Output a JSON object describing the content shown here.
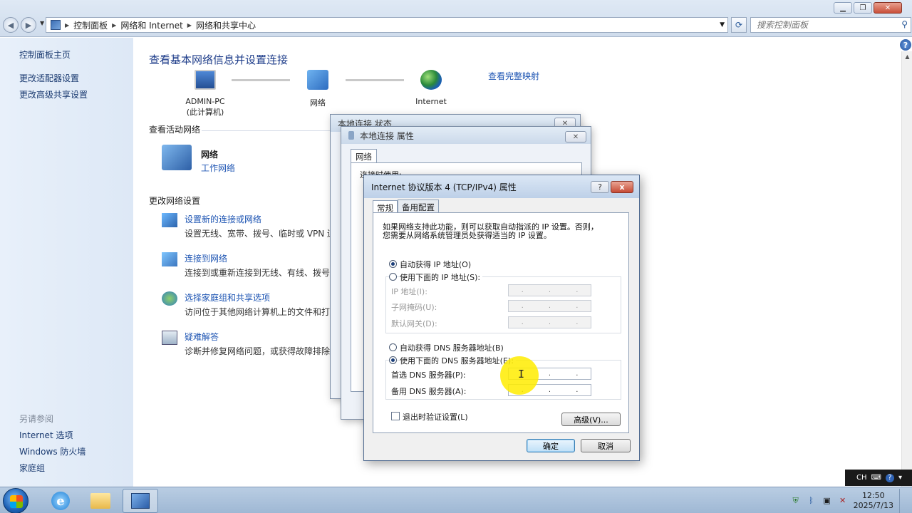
{
  "address": {
    "crumbs": [
      "控制面板",
      "网络和 Internet",
      "网络和共享中心"
    ],
    "search_placeholder": "搜索控制面板"
  },
  "sidebar": {
    "items": [
      "控制面板主页",
      "更改适配器设置",
      "更改高级共享设置"
    ],
    "see_also_title": "另请参阅",
    "see_also": [
      "Internet 选项",
      "Windows 防火墙",
      "家庭组"
    ]
  },
  "main": {
    "title": "查看基本网络信息并设置连接",
    "map": {
      "pc_name": "ADMIN-PC",
      "pc_sub": "(此计算机)",
      "network": "网络",
      "internet": "Internet",
      "full_map_link": "查看完整映射"
    },
    "active_title": "查看活动网络",
    "active_network_name": "网络",
    "active_network_type": "工作网络",
    "change_title": "更改网络设置",
    "tasks": [
      {
        "label": "设置新的连接或网络",
        "desc": "设置无线、宽带、拨号、临时或 VPN 连"
      },
      {
        "label": "连接到网络",
        "desc": "连接到或重新连接到无线、有线、拨号或"
      },
      {
        "label": "选择家庭组和共享选项",
        "desc": "访问位于其他网络计算机上的文件和打印"
      },
      {
        "label": "疑难解答",
        "desc": "诊断并修复网络问题，或获得故障排除信"
      }
    ]
  },
  "bg_dialog1": {
    "title": "本地连接 状态"
  },
  "bg_dialog2": {
    "title": "本地连接 属性",
    "tab": "网络",
    "connect_using": "连接时使用:"
  },
  "ipv4_dialog": {
    "title": "Internet 协议版本 4 (TCP/IPv4) 属性",
    "help_btn": "?",
    "close_btn": "x",
    "tabs": [
      "常规",
      "备用配置"
    ],
    "intro_line1": "如果网络支持此功能，则可以获取自动指派的 IP 设置。否则，",
    "intro_line2": "您需要从网络系统管理员处获得适当的 IP 设置。",
    "auto_ip": "自动获得 IP 地址(O)",
    "manual_ip": "使用下面的 IP 地址(S):",
    "ip_address": "IP 地址(I):",
    "subnet": "子网掩码(U):",
    "gateway": "默认网关(D):",
    "auto_dns": "自动获得 DNS 服务器地址(B)",
    "manual_dns": "使用下面的 DNS 服务器地址(E):",
    "preferred_dns": "首选 DNS 服务器(P):",
    "alternate_dns": "备用 DNS 服务器(A):",
    "validate": "退出时验证设置(L)",
    "advanced": "高级(V)...",
    "ok": "确定",
    "cancel": "取消"
  },
  "taskbar": {
    "lang": "CH",
    "time": "12:50",
    "date": "2025/7/13"
  }
}
